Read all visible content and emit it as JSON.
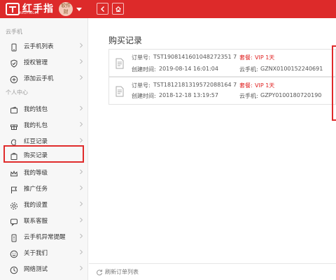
{
  "header": {
    "logo_text": "红手指",
    "logo_sub": "REDFINGER",
    "avatar_text": "软件财",
    "accent": "#dd2a2a"
  },
  "sidebar": {
    "section1": "云手机",
    "section2": "个人中心",
    "items": [
      {
        "label": "云手机列表",
        "icon": "phone-icon"
      },
      {
        "label": "授权管理",
        "icon": "shield-icon"
      },
      {
        "label": "添加云手机",
        "icon": "plus-circle-icon"
      },
      {
        "label": "我的钱包",
        "icon": "wallet-icon"
      },
      {
        "label": "我的礼包",
        "icon": "gift-icon"
      },
      {
        "label": "红豆记录",
        "icon": "bean-icon"
      },
      {
        "label": "购买记录",
        "icon": "cart-icon"
      },
      {
        "label": "我的等级",
        "icon": "crown-icon"
      },
      {
        "label": "推广任务",
        "icon": "flag-icon"
      },
      {
        "label": "我的设置",
        "icon": "gear-icon"
      },
      {
        "label": "联系客服",
        "icon": "chat-icon"
      },
      {
        "label": "云手机异常提醒",
        "icon": "alert-phone-icon"
      },
      {
        "label": "关于我们",
        "icon": "smile-icon"
      },
      {
        "label": "网络测试",
        "icon": "network-icon"
      }
    ]
  },
  "main": {
    "title": "购买记录",
    "orders": [
      {
        "order_label": "订单号:",
        "order_no": "TST1908141601048272351 7",
        "created_label": "创建时间:",
        "created": "2019-08-14 16:01:04",
        "package_label": "套餐:",
        "package": "VIP 1天",
        "phone_label": "云手机:",
        "phone": "GZNX0100152240691"
      },
      {
        "order_label": "订单号:",
        "order_no": "TST1812181319572088164 7",
        "created_label": "创建时间:",
        "created": "2018-12-18 13:19:57",
        "package_label": "套餐:",
        "package": "VIP 1天",
        "phone_label": "云手机:",
        "phone": "GZPY0100180720190"
      }
    ],
    "refresh_label": "刷新订单列表"
  }
}
